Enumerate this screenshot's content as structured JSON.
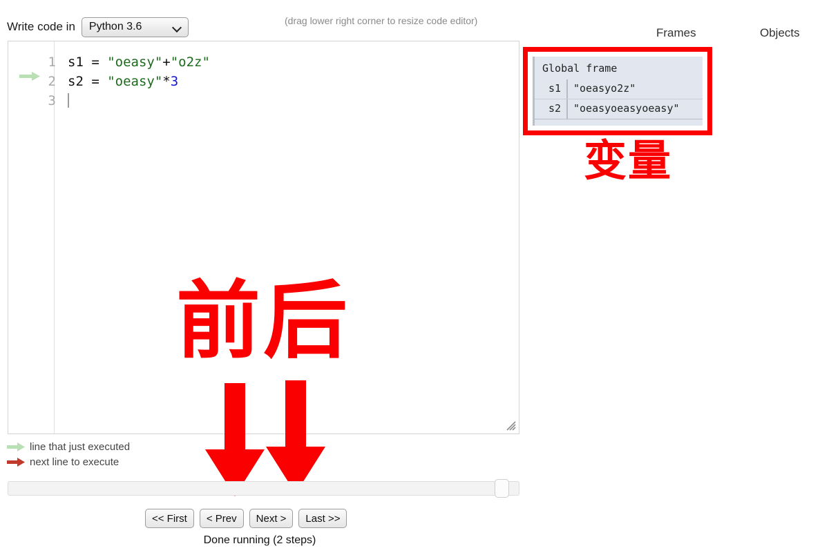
{
  "toolbar": {
    "write_label": "Write code in",
    "language": "Python 3.6",
    "resize_hint": "(drag lower right corner to resize code editor)"
  },
  "panels": {
    "frames_header": "Frames",
    "objects_header": "Objects"
  },
  "editor": {
    "lines": [
      {
        "number": "1",
        "marker": "none",
        "tokens": [
          {
            "text": "s1 = ",
            "type": "plain"
          },
          {
            "text": "\"oeasy\"",
            "type": "string"
          },
          {
            "text": "+",
            "type": "op"
          },
          {
            "text": "\"o2z\"",
            "type": "string"
          }
        ]
      },
      {
        "number": "2",
        "marker": "green-arrow",
        "tokens": [
          {
            "text": "s2 = ",
            "type": "plain"
          },
          {
            "text": "\"oeasy\"",
            "type": "string"
          },
          {
            "text": "*",
            "type": "op"
          },
          {
            "text": "3",
            "type": "number"
          }
        ]
      },
      {
        "number": "3",
        "marker": "none",
        "tokens": []
      }
    ]
  },
  "global_frame": {
    "title": "Global frame",
    "variables": [
      {
        "name": "s1",
        "value": "\"oeasyo2z\""
      },
      {
        "name": "s2",
        "value": "\"oeasyoeasyoeasy\""
      }
    ]
  },
  "annotations": {
    "variable_label": "变量",
    "prevnext_label": "前后"
  },
  "legend": [
    {
      "icon": "green-arrow-icon",
      "text": "line that just executed"
    },
    {
      "icon": "red-arrow-icon",
      "text": "next line to execute"
    }
  ],
  "nav": {
    "first": "<< First",
    "prev": "< Prev",
    "next": "Next >",
    "last": "Last >>"
  },
  "status": "Done running (2 steps)",
  "colors": {
    "annotation_red": "#fb0000",
    "string_green": "#1d6b1d",
    "number_blue": "#1414d6",
    "frame_bg": "#e2e7ef",
    "executed_arrow_green": "#b9dfb4",
    "next_arrow_red": "#c0392b"
  }
}
